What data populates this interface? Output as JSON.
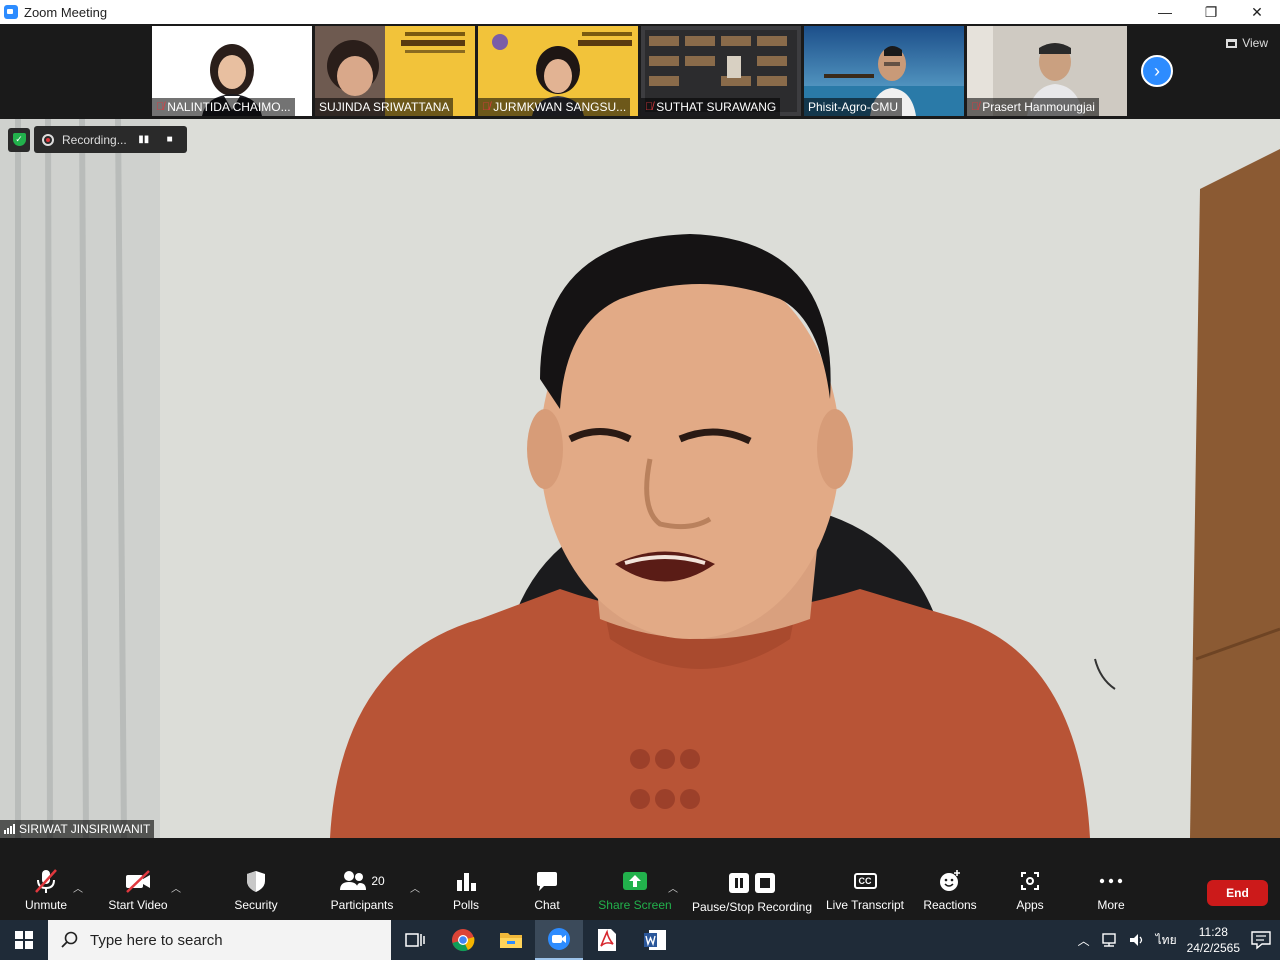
{
  "window": {
    "title": "Zoom Meeting",
    "minimize": "—",
    "restore": "❐",
    "close": "✕"
  },
  "gallery": {
    "view_label": "View",
    "next_icon": "chevron-right-icon",
    "participants": [
      {
        "name": "NALINTIDA CHAIMO...",
        "muted": true
      },
      {
        "name": "SUJINDA SRIWATTANA",
        "muted": false
      },
      {
        "name": "JURMKWAN SANGSU...",
        "muted": true
      },
      {
        "name": "SUTHAT SURAWANG",
        "muted": true
      },
      {
        "name": "Phisit-Agro-CMU",
        "muted": false
      },
      {
        "name": "Prasert Hanmoungjai",
        "muted": true
      }
    ]
  },
  "recording": {
    "label": "Recording..."
  },
  "active_speaker": {
    "name": "SIRIWAT JINSIRIWANIT"
  },
  "toolbar": {
    "unmute": "Unmute",
    "start_video": "Start Video",
    "security": "Security",
    "participants": "Participants",
    "participants_count": "20",
    "polls": "Polls",
    "chat": "Chat",
    "share_screen": "Share Screen",
    "pause_stop_recording": "Pause/Stop Recording",
    "cc_badge": "CC",
    "live_transcript": "Live Transcript",
    "reactions": "Reactions",
    "apps": "Apps",
    "more": "More",
    "end": "End"
  },
  "taskbar": {
    "search_placeholder": "Type here to search",
    "language": "ไทย",
    "time": "11:28",
    "date": "24/2/2565"
  },
  "colors": {
    "accent": "#2d8cff",
    "end": "#cc1a1a",
    "share": "#22b14c",
    "muted": "#e0383e"
  }
}
